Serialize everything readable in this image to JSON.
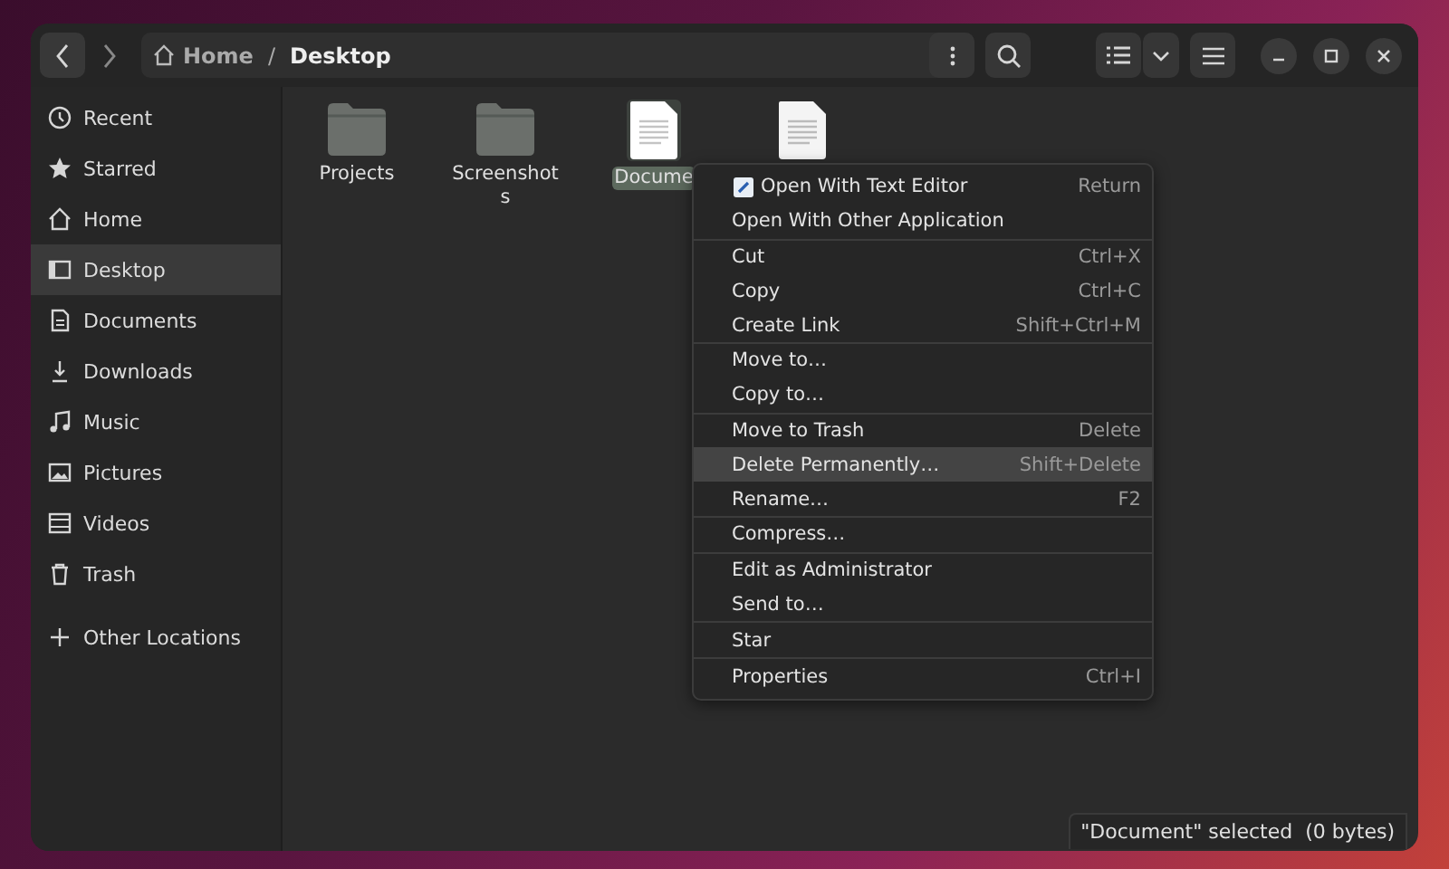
{
  "header": {
    "path": [
      {
        "label": "Home",
        "kind": "home"
      },
      {
        "label": "/",
        "kind": "separator"
      },
      {
        "label": "Desktop",
        "kind": "current"
      }
    ]
  },
  "sidebar": {
    "items": [
      {
        "label": "Recent",
        "selected": false
      },
      {
        "label": "Starred",
        "selected": false
      },
      {
        "label": "Home",
        "selected": false
      },
      {
        "label": "Desktop",
        "selected": true
      },
      {
        "label": "Documents",
        "selected": false
      },
      {
        "label": "Downloads",
        "selected": false
      },
      {
        "label": "Music",
        "selected": false
      },
      {
        "label": "Pictures",
        "selected": false
      },
      {
        "label": "Videos",
        "selected": false
      },
      {
        "label": "Trash",
        "selected": false
      }
    ],
    "other": {
      "label": "Other Locations"
    }
  },
  "files": [
    {
      "name": "Projects",
      "kind": "folder",
      "selected": false
    },
    {
      "name": "Screenshots",
      "kind": "folder",
      "selected": false
    },
    {
      "name": "Docume",
      "kind": "document",
      "selected": true
    },
    {
      "kind": "document",
      "selected": false
    }
  ],
  "context_menu": {
    "sections": [
      [
        {
          "label": "Open With Text Editor",
          "shortcut": "Return",
          "kind": "with-icon",
          "selected": false
        },
        {
          "label": "Open With Other Application",
          "kind": "plain",
          "selected": false
        }
      ],
      [
        {
          "label": "Cut",
          "shortcut": "Ctrl+X",
          "kind": "plain",
          "selected": false
        },
        {
          "label": "Copy",
          "shortcut": "Ctrl+C",
          "kind": "plain",
          "selected": false
        },
        {
          "label": "Create Link",
          "shortcut": "Shift+Ctrl+M",
          "kind": "plain",
          "selected": false
        }
      ],
      [
        {
          "label": "Move to…",
          "kind": "plain",
          "selected": false
        },
        {
          "label": "Copy to…",
          "kind": "plain",
          "selected": false
        }
      ],
      [
        {
          "label": "Move to Trash",
          "shortcut": "Delete",
          "kind": "plain",
          "selected": false
        },
        {
          "label": "Delete Permanently…",
          "shortcut": "Shift+Delete",
          "kind": "plain",
          "selected": true
        },
        {
          "label": "Rename…",
          "shortcut": "F2",
          "kind": "plain",
          "selected": false
        }
      ],
      [
        {
          "label": "Compress…",
          "kind": "plain",
          "selected": false
        }
      ],
      [
        {
          "label": "Edit as Administrator",
          "kind": "plain",
          "selected": false
        },
        {
          "label": "Send to…",
          "kind": "plain",
          "selected": false
        }
      ],
      [
        {
          "label": "Star",
          "kind": "plain",
          "selected": false
        }
      ],
      [
        {
          "label": "Properties",
          "shortcut": "Ctrl+I",
          "kind": "plain",
          "selected": false
        }
      ]
    ]
  },
  "status_bar": {
    "text": "\"Document\" selected  (0 bytes)"
  }
}
